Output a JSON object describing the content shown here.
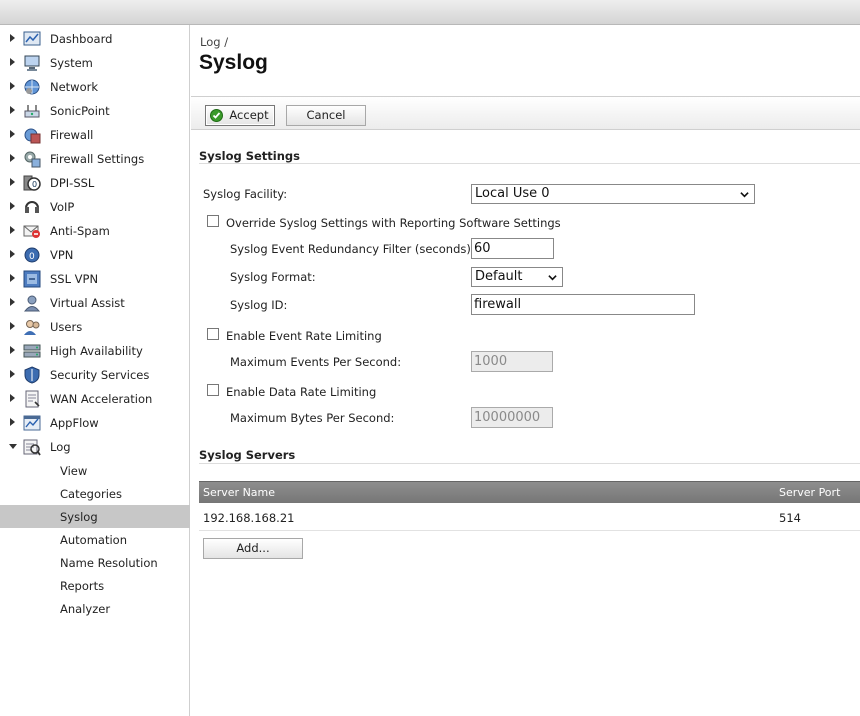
{
  "sidebar": {
    "items": [
      {
        "label": "Dashboard",
        "icon": "dashboard-icon"
      },
      {
        "label": "System",
        "icon": "system-icon"
      },
      {
        "label": "Network",
        "icon": "network-icon"
      },
      {
        "label": "SonicPoint",
        "icon": "sonicpoint-icon"
      },
      {
        "label": "Firewall",
        "icon": "firewall-icon"
      },
      {
        "label": "Firewall Settings",
        "icon": "firewall-settings-icon"
      },
      {
        "label": "DPI-SSL",
        "icon": "dpi-ssl-icon"
      },
      {
        "label": "VoIP",
        "icon": "voip-icon"
      },
      {
        "label": "Anti-Spam",
        "icon": "anti-spam-icon"
      },
      {
        "label": "VPN",
        "icon": "vpn-icon"
      },
      {
        "label": "SSL VPN",
        "icon": "ssl-vpn-icon"
      },
      {
        "label": "Virtual Assist",
        "icon": "virtual-assist-icon"
      },
      {
        "label": "Users",
        "icon": "users-icon"
      },
      {
        "label": "High Availability",
        "icon": "high-availability-icon"
      },
      {
        "label": "Security Services",
        "icon": "security-services-icon"
      },
      {
        "label": "WAN Acceleration",
        "icon": "wan-acceleration-icon"
      },
      {
        "label": "AppFlow",
        "icon": "appflow-icon"
      },
      {
        "label": "Log",
        "icon": "log-icon"
      }
    ],
    "log_subitems": [
      "View",
      "Categories",
      "Syslog",
      "Automation",
      "Name Resolution",
      "Reports",
      "Analyzer"
    ],
    "active_subitem": "Syslog"
  },
  "header": {
    "breadcrumb": "Log /",
    "title": "Syslog"
  },
  "toolbar": {
    "accept_label": "Accept",
    "cancel_label": "Cancel"
  },
  "settings": {
    "section_title": "Syslog Settings",
    "facility_label": "Syslog Facility:",
    "facility_value": "Local Use 0",
    "override_label": "Override Syslog Settings with Reporting Software Settings",
    "redundancy_label": "Syslog Event Redundancy Filter (seconds):",
    "redundancy_value": "60",
    "format_label": "Syslog Format:",
    "format_value": "Default",
    "id_label": "Syslog ID:",
    "id_value": "firewall",
    "event_rate_label": "Enable Event Rate Limiting",
    "max_events_label": "Maximum Events Per Second:",
    "max_events_value": "1000",
    "data_rate_label": "Enable Data Rate Limiting",
    "max_bytes_label": "Maximum Bytes Per Second:",
    "max_bytes_value": "10000000"
  },
  "servers": {
    "section_title": "Syslog Servers",
    "columns": [
      "Server Name",
      "Server Port"
    ],
    "rows": [
      {
        "name": "192.168.168.21",
        "port": "514"
      }
    ],
    "add_label": "Add..."
  },
  "colors": {
    "active_item_bg": "#c7c7c7",
    "table_header_bg": "#808080",
    "accept_check": "#3a9a2a"
  }
}
